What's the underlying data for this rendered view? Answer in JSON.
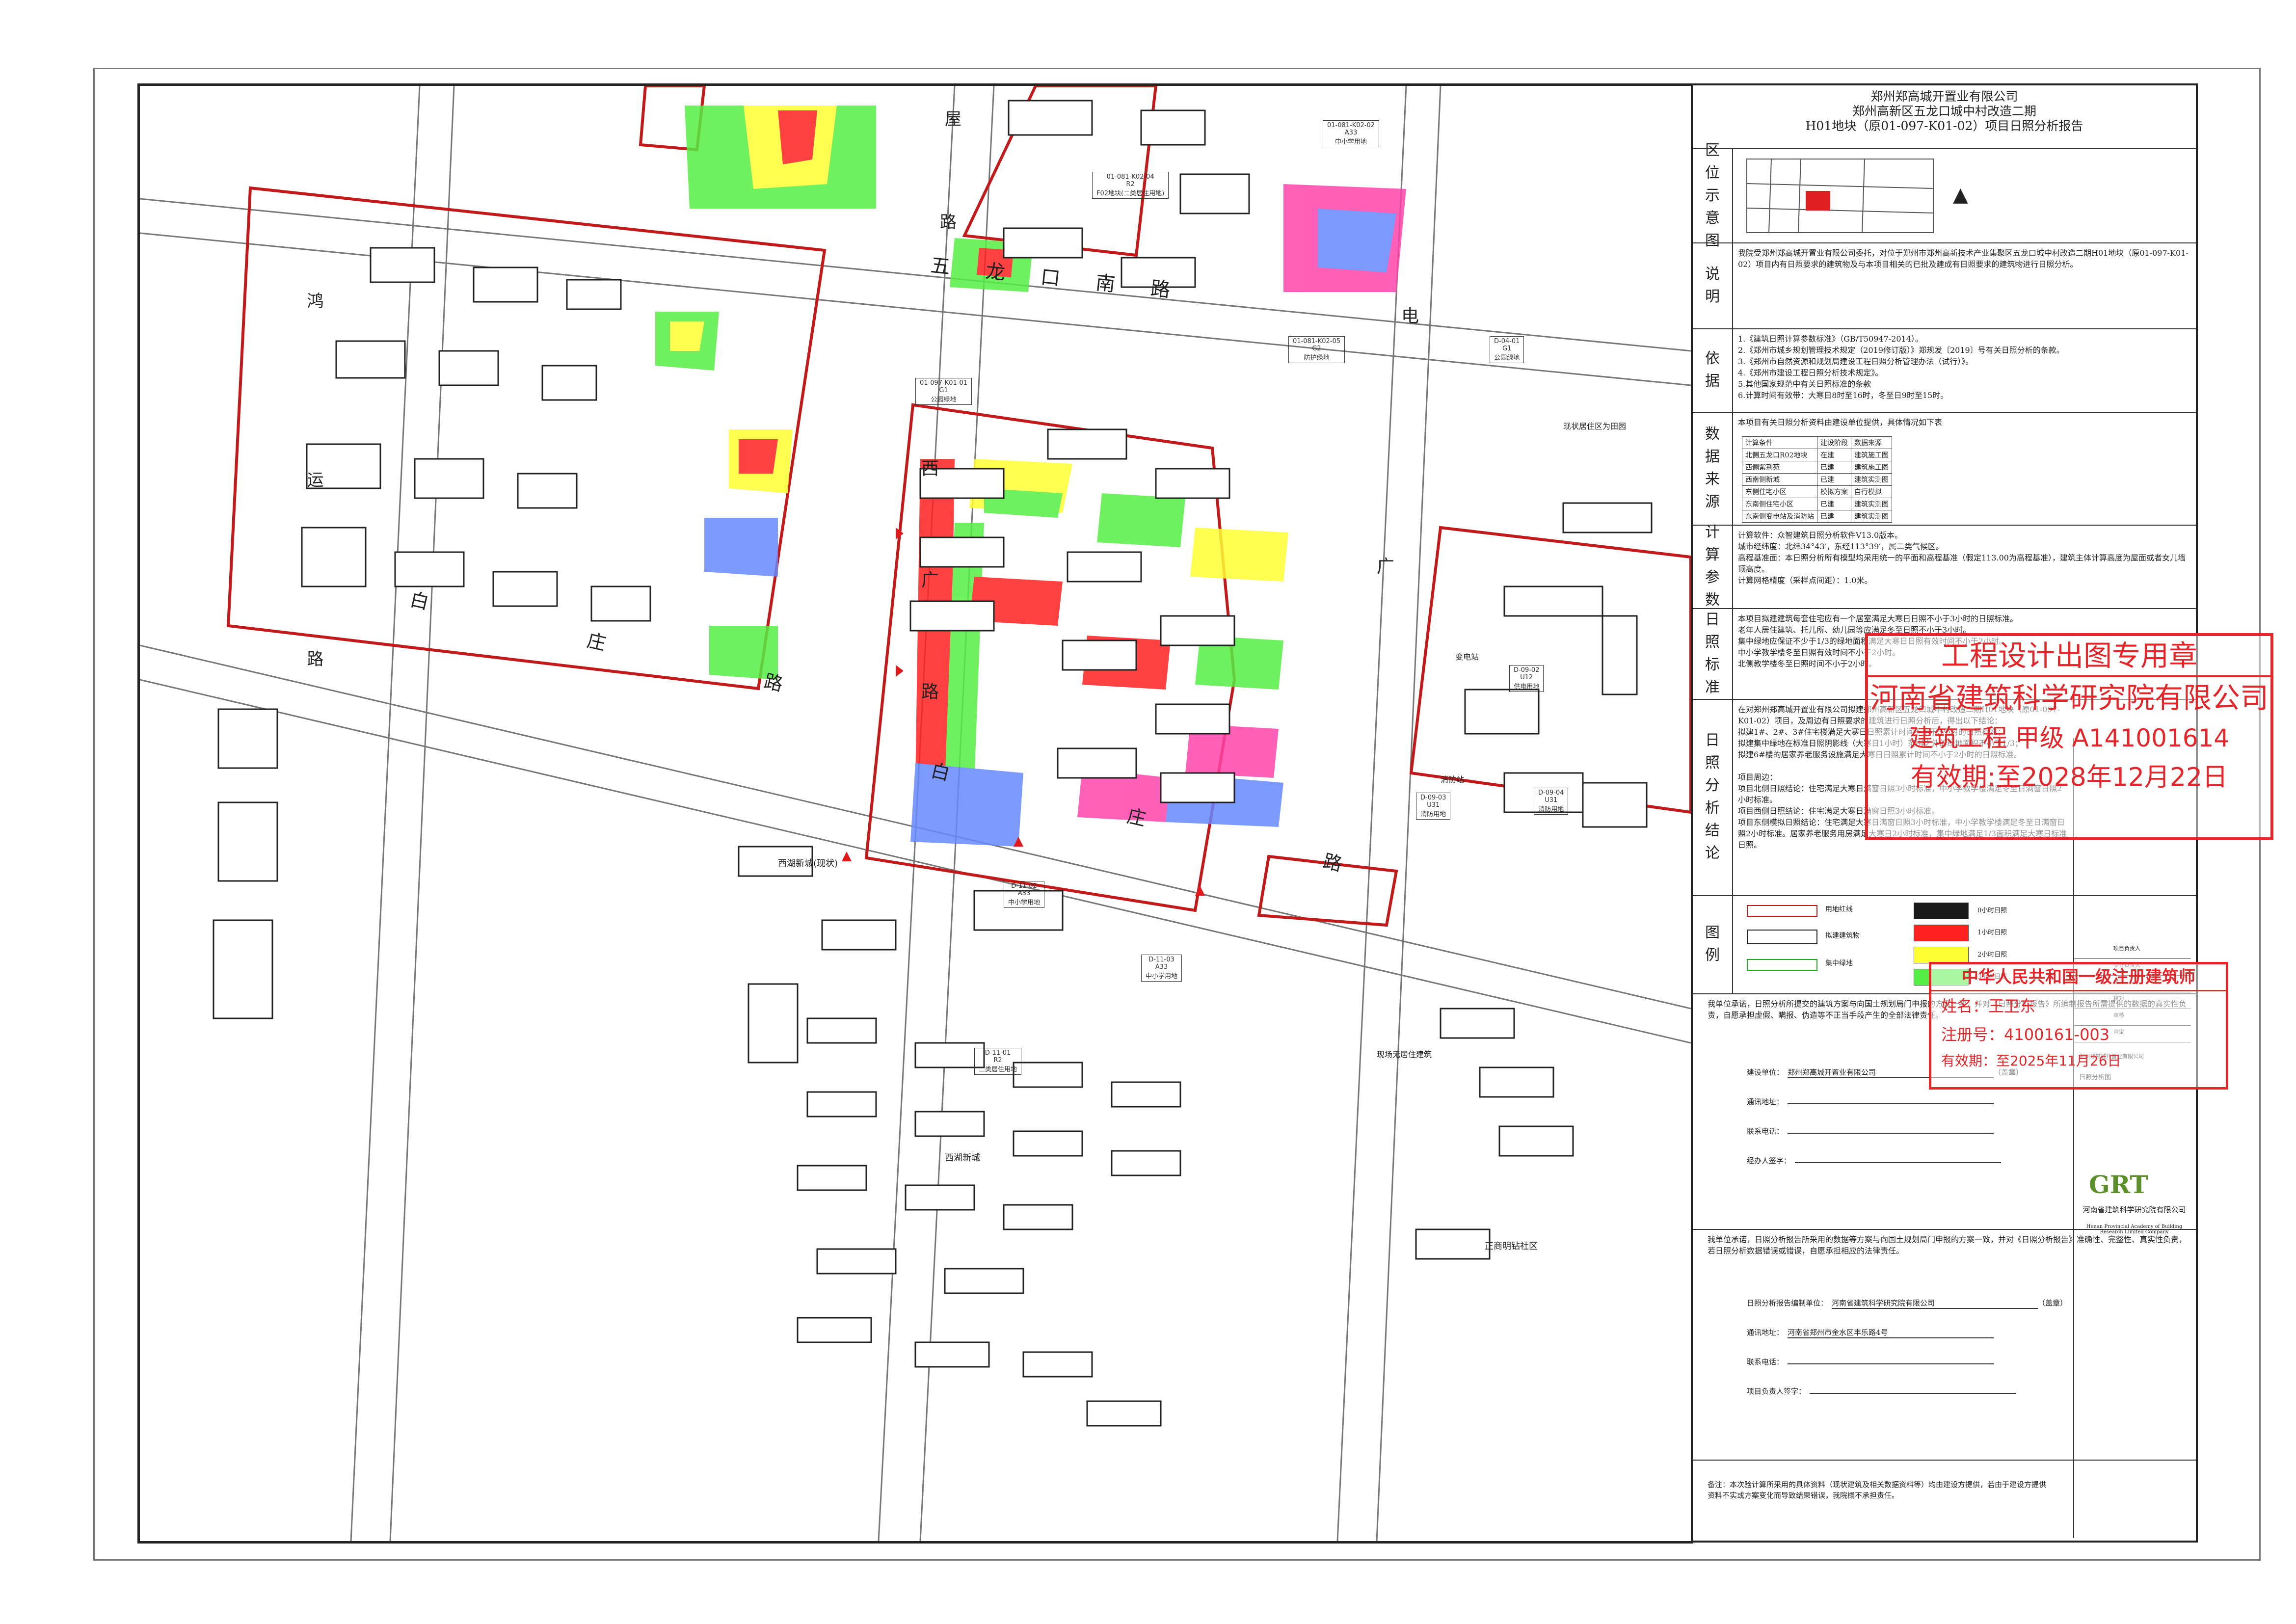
{
  "map": {
    "roads": {
      "wulongkou_south_road": "五 龙 口 南 路",
      "baizhuang_road_west": "白 庄 路",
      "baizhuang_road_east": "白 庄 路",
      "xiguang_road": "西 广 路",
      "wu_road_label": "鸿 运 路",
      "dian_char": "电",
      "guang_char": "广",
      "wu_char": "屋",
      "lu_char": "路"
    },
    "parcels": [
      {
        "code": "01-097-K01-01",
        "use": "G1",
        "desc": "公园绿地"
      },
      {
        "code": "01-081-K02-04",
        "use": "R2",
        "desc": "F02地块(二类居住用地)"
      },
      {
        "code": "01-081-K02-02",
        "use": "A33",
        "desc": "中小学用地"
      },
      {
        "code": "01-081-K02-05",
        "use": "G2",
        "desc": "防护绿地"
      },
      {
        "code": "D-04-01",
        "use": "G1",
        "desc": "公园绿地"
      },
      {
        "code": "D-09-02",
        "use": "U12",
        "desc": "供电用地"
      },
      {
        "code": "D-09-03",
        "use": "U31",
        "desc": "消防用地"
      },
      {
        "code": "D-09-04",
        "use": "U31",
        "desc": "消防用地"
      },
      {
        "code": "D-11-02",
        "use": "A33",
        "desc": "中小学用地"
      },
      {
        "code": "D-11-03",
        "use": "A33",
        "desc": "中小学用地"
      },
      {
        "code": "D-11-01",
        "use": "R2",
        "desc": "二类居住用地"
      }
    ],
    "labels": {
      "xihu_new_city": "西湖新城(现状)",
      "xihu_new_city2": "西湖新城",
      "zhengshang_mingzhu": "正商明钻社区",
      "existing_buildings": "现场无居住建筑",
      "substation": "变电站",
      "fire_station": "消防站",
      "existing_note": "现状居住区为田园"
    }
  },
  "header": {
    "company": "郑州郑高城开置业有限公司",
    "project": "郑州高新区五龙口城中村改造二期",
    "report": "H01地块（原01-097-K01-02）项目日照分析报告"
  },
  "sections": {
    "location": {
      "label": "区位示意图"
    },
    "description": {
      "label": "说明",
      "text": "我院受郑州郑高城开置业有限公司委托，对位于郑州市郑州高新技术产业集聚区五龙口城中村改造二期H01地块（原01-097-K01-02）项目内有日照要求的建筑物及与本项目相关的已批及建成有日照要求的建筑物进行日照分析。"
    },
    "basis": {
      "label": "依据",
      "text": "1.《建筑日照计算参数标准》（GB/T50947-2014）。\n2.《郑州市城乡规划管理技术规定（2019修订版）》郑规发〔2019〕号有关日照分析的条款。\n3.《郑州市自然资源和规划局建设工程日照分析管理办法（试行）》。\n4.《郑州市建设工程日照分析技术规定》。\n5.其他国家规范中有关日照标准的条款\n6.计算时间有效带：大寒日8时至16时，冬至日9时至15时。"
    },
    "data_source": {
      "label": "数据来源",
      "intro": "本项目有关日照分析资料由建设单位提供，具体情况如下表",
      "headers": [
        "计算条件",
        "建设阶段",
        "数据来源"
      ],
      "rows": [
        [
          "北侧五龙口R02地块",
          "在建",
          "建筑施工图"
        ],
        [
          "西侧紫荆苑",
          "已建",
          "建筑施工图"
        ],
        [
          "西南侧新城",
          "已建",
          "建筑实测图"
        ],
        [
          "东侧住宅小区",
          "模拟方案",
          "自行模拟"
        ],
        [
          "东南侧住宅小区",
          "已建",
          "建筑实测图"
        ],
        [
          "东南侧变电站及消防站",
          "已建",
          "建筑实测图"
        ]
      ]
    },
    "params": {
      "label": "计算参数",
      "text": "计算软件：众智建筑日照分析软件V13.0版本。\n城市经纬度：北纬34°43′，东经113°39′，属二类气候区。\n高程基准面：本日照分析所有模型均采用统一的平面和高程基准（假定113.00为高程基准），建筑主体计算高度为屋面或者女儿墙顶高度。\n计算网格精度（采样点间距）：1.0米。"
    },
    "standard": {
      "label": "日照标准",
      "text": "本项目拟建建筑每套住宅应有一个居室满足大寒日日照不小于3小时的日照标准。\n老年人居住建筑、托儿所、幼儿园等应满足冬至日照不小于3小时。\n集中绿地应保证不少于1/3的绿地面积满足大寒日日照有效时间不小于2小时。\n中小学教学楼冬至日照有效时间不小于2小时。\n北侧教学楼冬至日照时间不小于2小时。"
    },
    "conclusion": {
      "label": "日照分析结论",
      "text": "在对郑州郑高城开置业有限公司拟建郑州高新区五龙口城中村改造二期H01地块（原01-097-K01-02）项目，及周边有日照要求的建筑进行日照分析后，得出以下结论：\n拟建1#、2#、3#住宅楼满足大寒日日照累计时间不小于3小时的日照标准；\n拟建集中绿地在标准日照阴影线（大寒日1小时）范围之外的绿地面积不小于1/3；\n拟建6#楼的居家养老服务设施满足大寒日日照累计时间不小于2小时的日照标准。\n\n项目周边：\n项目北侧日照结论：住宅满足大寒日满窗日照3小时标准，中小学教学楼满足冬至日满窗日照2小时标准。\n项目西侧日照结论：住宅满足大寒日满窗日照3小时标准。\n项目东侧模拟日照结论：住宅满足大寒日满窗日照3小时标准，中小学教学楼满足冬至日满窗日照2小时标准。居家养老服务用房满足大寒日2小时标准，集中绿地满足1/3面积满足大寒日标准日照。"
    },
    "legend": {
      "label": "图例",
      "items": [
        {
          "sym": "red-line",
          "text": "用地红线"
        },
        {
          "sym": "building",
          "text": "拟建建筑物"
        },
        {
          "sym": "green-line",
          "text": "集中绿地"
        }
      ],
      "colors": [
        {
          "hex": "#1a1a1a",
          "text": "0小时日照"
        },
        {
          "hex": "#ff2020",
          "text": "1小时日照"
        },
        {
          "hex": "#ffff33",
          "text": "2小时日照"
        },
        {
          "hex": "#55ee44",
          "text": "3小时日照"
        }
      ]
    }
  },
  "commitments": {
    "builder_text": "我单位承诺，日照分析所提交的建筑方案与向国土规划局门申报的方案一致，并对《日照分析报告》所编制报告所需提供的数据的真实性负责，自愿承担虚假、瞒报、伪造等不正当手段产生的全部法律责任。",
    "builder_unit_label": "建设单位：",
    "builder_unit": "郑州郑高城开置业有限公司",
    "seal": "（盖章）",
    "addr_label": "通讯地址：",
    "phone_label": "联系电话：",
    "proxy_label": "经办人签字：",
    "consultant_text": "我单位承诺，日照分析报告所采用的数据等方案与向国土规划局门申报的方案一致，并对《日照分析报告》准确性、完整性、真实性负责，若日照分析数据错误或错误，自愿承担相应的法律责任。",
    "consultant_unit_label": "日照分析报告编制单位：",
    "consultant_unit": "河南省建筑科学研究院有限公司",
    "consultant_addr": "河南省郑州市金水区丰乐路4号",
    "leader_label": "项目负责人签字：",
    "note": "备注：本次验计算所采用的具体资料（现状建筑及相关数据资料等）均由建设方提供，若由于建设方提供资料不实或方案变化而导致结果错误，我院概不承担责任。"
  },
  "stamps": {
    "s1_title": "工程设计出图专用章",
    "s1_company": "河南省建筑科学研究院有限公司",
    "s1_grade": "建筑工程 甲级 A141001614",
    "s1_valid": "有效期:至2028年12月22日",
    "s2_title": "中华人民共和国一级注册建筑师",
    "s2_name": "姓名：王卫东",
    "s2_no": "注册号：4100161-003",
    "s2_valid": "有效期：至2025年11月26日"
  },
  "title_block": {
    "institute": "河南省建筑科学研究院有限公司",
    "institute_en": "Henan Provincial Academy of Building Research Limited Company",
    "logo_text": "GRT",
    "roles": [
      "项目负责人",
      "专业负责人",
      "设计",
      "校对",
      "审核",
      "审定"
    ],
    "drawing_name": "日照分析图",
    "client": "郑州郑高城开置业有限公司"
  }
}
